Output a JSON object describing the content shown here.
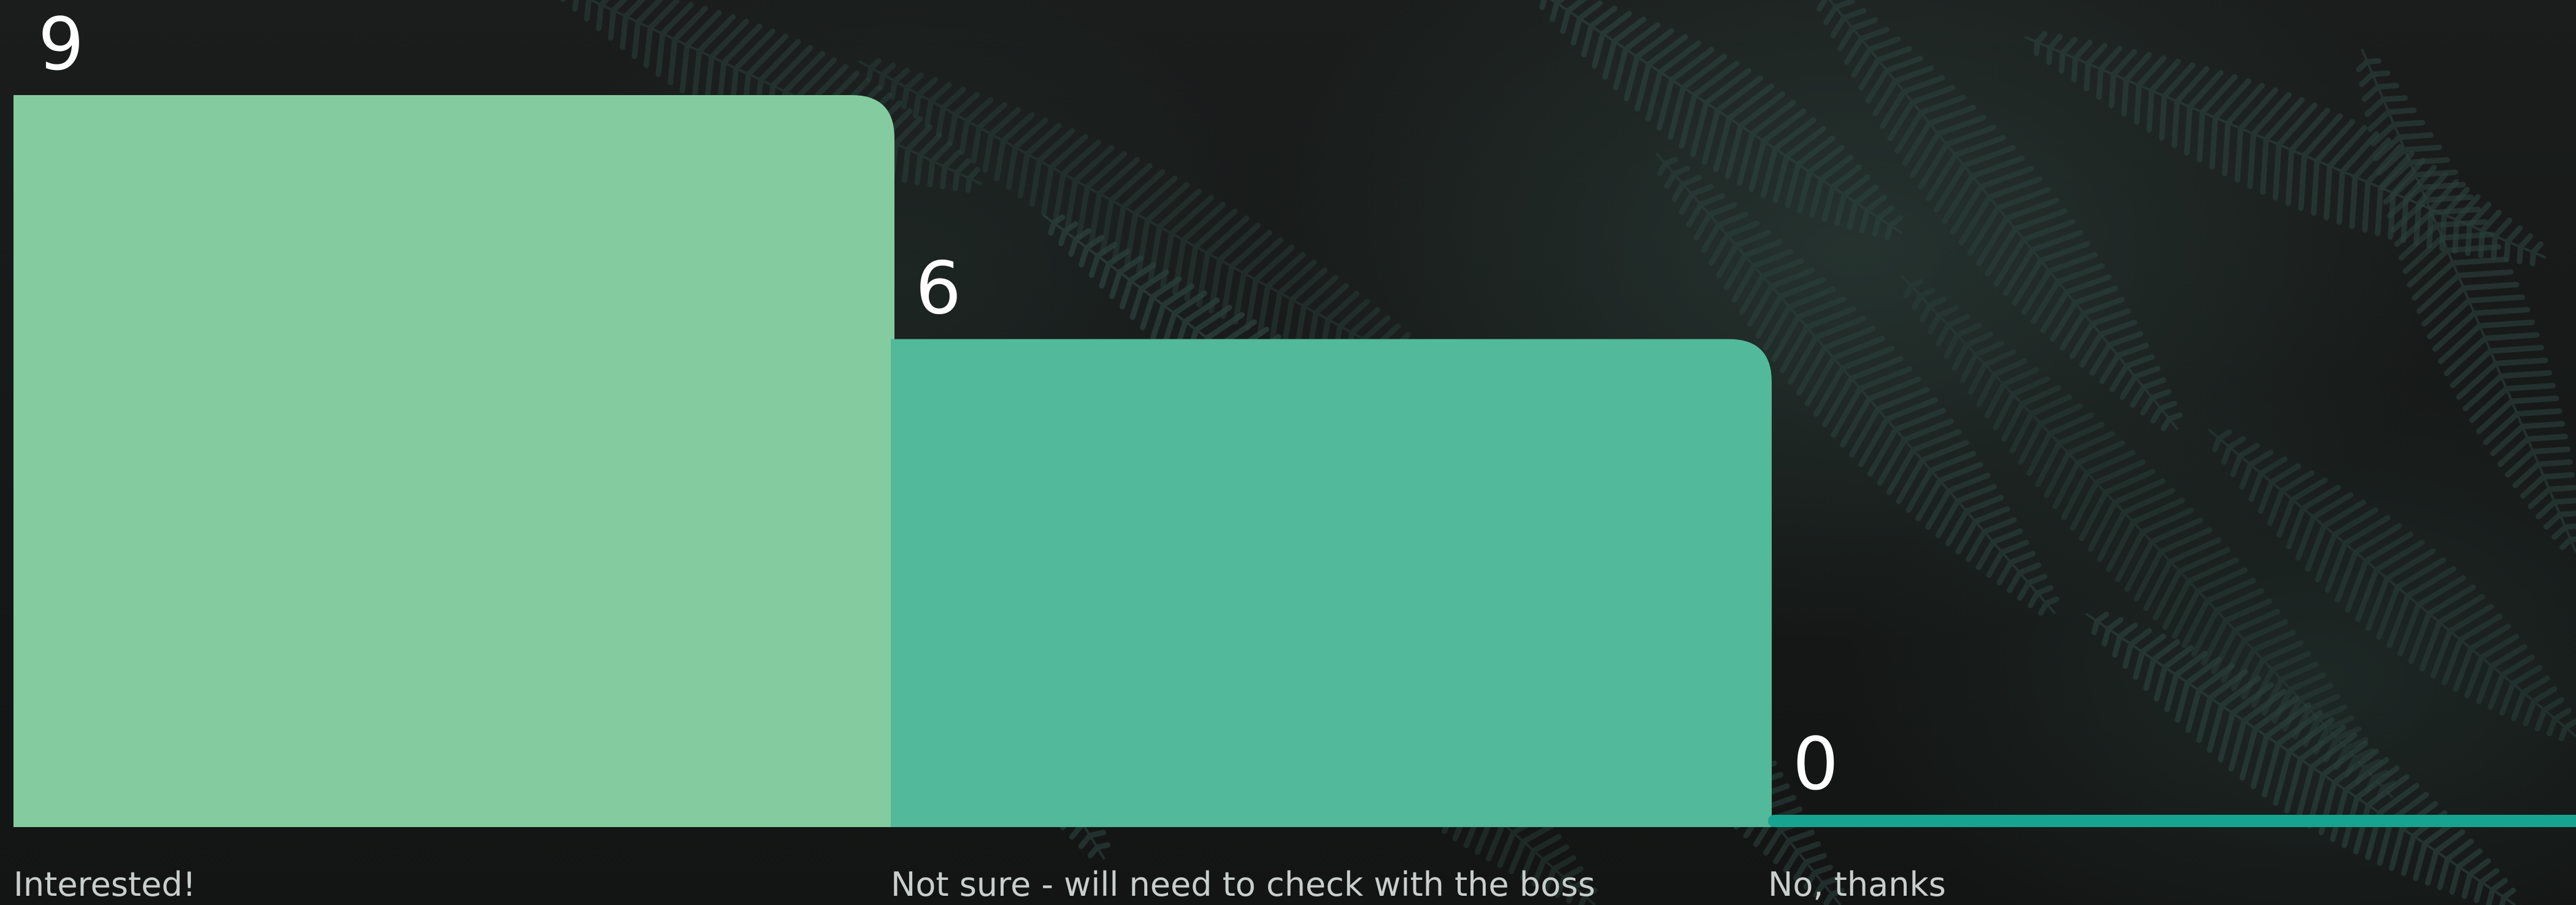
{
  "chart_data": {
    "type": "bar",
    "categories": [
      "Interested!",
      "Not sure - will need to check with the boss",
      "No, thanks"
    ],
    "values": [
      9,
      6,
      0
    ],
    "ylim": [
      0,
      9
    ],
    "grid": false,
    "colors": [
      "#84cc9f",
      "#52b99a",
      "#16a491"
    ]
  },
  "background": {
    "image": "dark-fern-leaves",
    "base_color": "#151716",
    "leaf_color": "#2b3f3b"
  }
}
